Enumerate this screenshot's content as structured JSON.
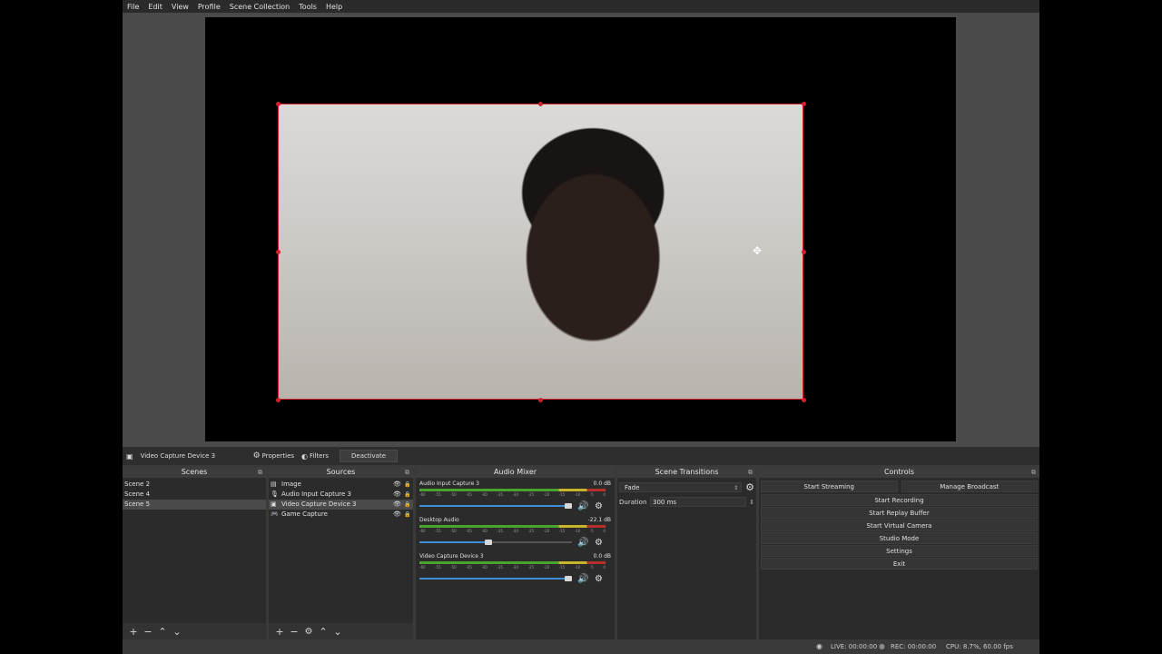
{
  "menu": [
    "File",
    "Edit",
    "View",
    "Profile",
    "Scene Collection",
    "Tools",
    "Help"
  ],
  "sourcebar": {
    "icon": "camera-icon",
    "source_name": "Video Capture Device 3",
    "properties": "Properties",
    "filters": "Filters",
    "deactivate": "Deactivate"
  },
  "scenes": {
    "title": "Scenes",
    "items": [
      "Scene 2",
      "Scene 4",
      "Scene 5"
    ],
    "selected": "Scene 5"
  },
  "sources": {
    "title": "Sources",
    "items": [
      {
        "icon": "image-icon",
        "label": "Image"
      },
      {
        "icon": "microphone-icon",
        "label": "Audio Input Capture 3"
      },
      {
        "icon": "camera-icon",
        "label": "Video Capture Device 3"
      },
      {
        "icon": "gamepad-icon",
        "label": "Game Capture"
      }
    ],
    "selected": "Video Capture Device 3"
  },
  "mixer": {
    "title": "Audio Mixer",
    "scale": [
      "-60",
      "-55",
      "-50",
      "-45",
      "-40",
      "-35",
      "-30",
      "-25",
      "-20",
      "-15",
      "-10",
      "-5",
      "0"
    ],
    "channels": [
      {
        "name": "Audio Input Capture 3",
        "db": "0.0 dB",
        "level": 1.0
      },
      {
        "name": "Desktop Audio",
        "db": "-22.1 dB",
        "level": 0.45
      },
      {
        "name": "Video Capture Device 3",
        "db": "0.0 dB",
        "level": 1.0
      }
    ]
  },
  "transitions": {
    "title": "Scene Transitions",
    "type": "Fade",
    "duration_label": "Duration",
    "duration_value": "300 ms"
  },
  "controls": {
    "title": "Controls",
    "start_streaming": "Start Streaming",
    "manage_broadcast": "Manage Broadcast",
    "start_recording": "Start Recording",
    "start_replay_buffer": "Start Replay Buffer",
    "start_virtual_camera": "Start Virtual Camera",
    "studio_mode": "Studio Mode",
    "settings": "Settings",
    "exit": "Exit"
  },
  "status": {
    "live": "LIVE: 00:00:00",
    "rec": "REC: 00:00:00",
    "cpu": "CPU: 8.7%, 60.00 fps"
  },
  "colors": {
    "selection_border": "#d0202a",
    "meter_green": "#4aa32e",
    "fader_blue": "#3f8fd6"
  }
}
